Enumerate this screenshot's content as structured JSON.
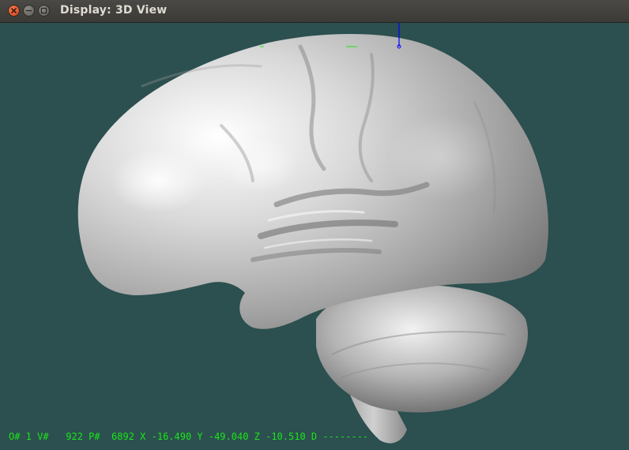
{
  "window": {
    "title": "Display: 3D View",
    "close_icon": "close-icon",
    "minimize_icon": "minimize-icon",
    "maximize_icon": "maximize-icon"
  },
  "viewport": {
    "background": "#2c4f4f",
    "model_color": "#c8c8c8",
    "axis_marker_color": "#0000ff",
    "cursor_marker_color": "#19e619"
  },
  "status_bar": {
    "text": "O# 1 V#   922 P#  6892 X -16.490 Y -49.040 Z -10.510 D --------"
  }
}
